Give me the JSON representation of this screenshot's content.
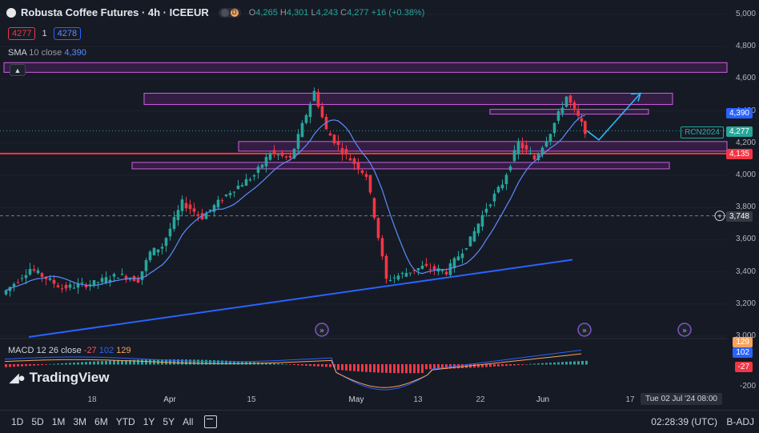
{
  "header": {
    "title": "Robusta Coffee Futures · 4h · ICEEUR",
    "toggle_letter": "D",
    "ohlc": {
      "o_label": "O",
      "o": "4,265",
      "h_label": "H",
      "h": "4,301",
      "l_label": "L",
      "l": "4,243",
      "c_label": "C",
      "c": "4,277",
      "change": "+16 (+0.38%)"
    },
    "bid": "4277",
    "spread": "1",
    "ask": "4278"
  },
  "indicators": {
    "sma_label": "SMA",
    "sma_params": "10 close",
    "sma_value": "4,390",
    "macd_label": "MACD",
    "macd_params": "12 26 close",
    "macd_hist": "-27",
    "macd_line": "102",
    "macd_signal": "129"
  },
  "brand": "TradingView",
  "price_axis": [
    "5,000",
    "4,800",
    "4,600",
    "4,400",
    "4,200",
    "4,000",
    "3,800",
    "3,600",
    "3,400",
    "3,200",
    "3,000"
  ],
  "macd_axis": [
    "-200"
  ],
  "price_tags": {
    "sma": "4,390",
    "symbol": "RCN2024",
    "last": "4,277",
    "level": "4,135",
    "crosshair": "3,748",
    "macd_signal": "129",
    "macd_line": "102",
    "macd_hist": "-27"
  },
  "time_axis": [
    {
      "label": "18",
      "bold": false
    },
    {
      "label": "Apr",
      "bold": true
    },
    {
      "label": "15",
      "bold": false
    },
    {
      "label": "May",
      "bold": true
    },
    {
      "label": "13",
      "bold": false
    },
    {
      "label": "22",
      "bold": false
    },
    {
      "label": "Jun",
      "bold": true
    },
    {
      "label": "17",
      "bold": false
    }
  ],
  "crosshair_date": "Tue 02 Jul '24  08:00",
  "bottom": {
    "ranges": [
      "1D",
      "5D",
      "1M",
      "3M",
      "6M",
      "YTD",
      "1Y",
      "5Y",
      "All"
    ],
    "clock": "02:28:39 (UTC)",
    "adj": "B-ADJ"
  },
  "colors": {
    "up": "#26a69a",
    "down": "#f23645",
    "sma": "#5b8cff",
    "zone": "#9c27b0",
    "trend": "#2962ff",
    "level": "#f23645"
  },
  "chart_data": {
    "type": "candlestick",
    "timeframe": "4h",
    "ylim": [
      3000,
      5000
    ],
    "price_path": [
      {
        "t": "Mar 08",
        "close": 3260
      },
      {
        "t": "Mar 11",
        "close": 3420
      },
      {
        "t": "Mar 14",
        "close": 3300
      },
      {
        "t": "Mar 18",
        "close": 3330
      },
      {
        "t": "Mar 21",
        "close": 3380
      },
      {
        "t": "Mar 25",
        "close": 3350
      },
      {
        "t": "Mar 27",
        "close": 3520
      },
      {
        "t": "Mar 29",
        "close": 3560
      },
      {
        "t": "Apr 03",
        "close": 3830
      },
      {
        "t": "Apr 05",
        "close": 3740
      },
      {
        "t": "Apr 10",
        "close": 3900
      },
      {
        "t": "Apr 15",
        "close": 4000
      },
      {
        "t": "Apr 17",
        "close": 4140
      },
      {
        "t": "Apr 19",
        "close": 4100
      },
      {
        "t": "Apr 23",
        "close": 4520
      },
      {
        "t": "Apr 24",
        "close": 4280
      },
      {
        "t": "Apr 26",
        "close": 4150
      },
      {
        "t": "May 01",
        "close": 4000
      },
      {
        "t": "May 03",
        "close": 3750
      },
      {
        "t": "May 07",
        "close": 3350
      },
      {
        "t": "May 10",
        "close": 3430
      },
      {
        "t": "May 15",
        "close": 3400
      },
      {
        "t": "May 20",
        "close": 3600
      },
      {
        "t": "May 22",
        "close": 3800
      },
      {
        "t": "May 24",
        "close": 3950
      },
      {
        "t": "May 27",
        "close": 4200
      },
      {
        "t": "May 29",
        "close": 4100
      },
      {
        "t": "May 31",
        "close": 4270
      },
      {
        "t": "Jun 03",
        "close": 4490
      },
      {
        "t": "Jun 04",
        "close": 4400
      },
      {
        "t": "Jun 05",
        "close": 4277
      }
    ],
    "sma": {
      "period": 10,
      "last": 4390
    },
    "zones": [
      {
        "low": 4640,
        "high": 4700
      },
      {
        "low": 4440,
        "high": 4510
      },
      {
        "low": 4380,
        "high": 4410
      },
      {
        "low": 4150,
        "high": 4210
      },
      {
        "low": 4040,
        "high": 4080
      }
    ],
    "horizontal_levels": [
      4135,
      3748
    ],
    "macd": {
      "fast": 12,
      "slow": 26,
      "source": "close",
      "histogram": -27,
      "macd": 102,
      "signal": 129
    }
  }
}
